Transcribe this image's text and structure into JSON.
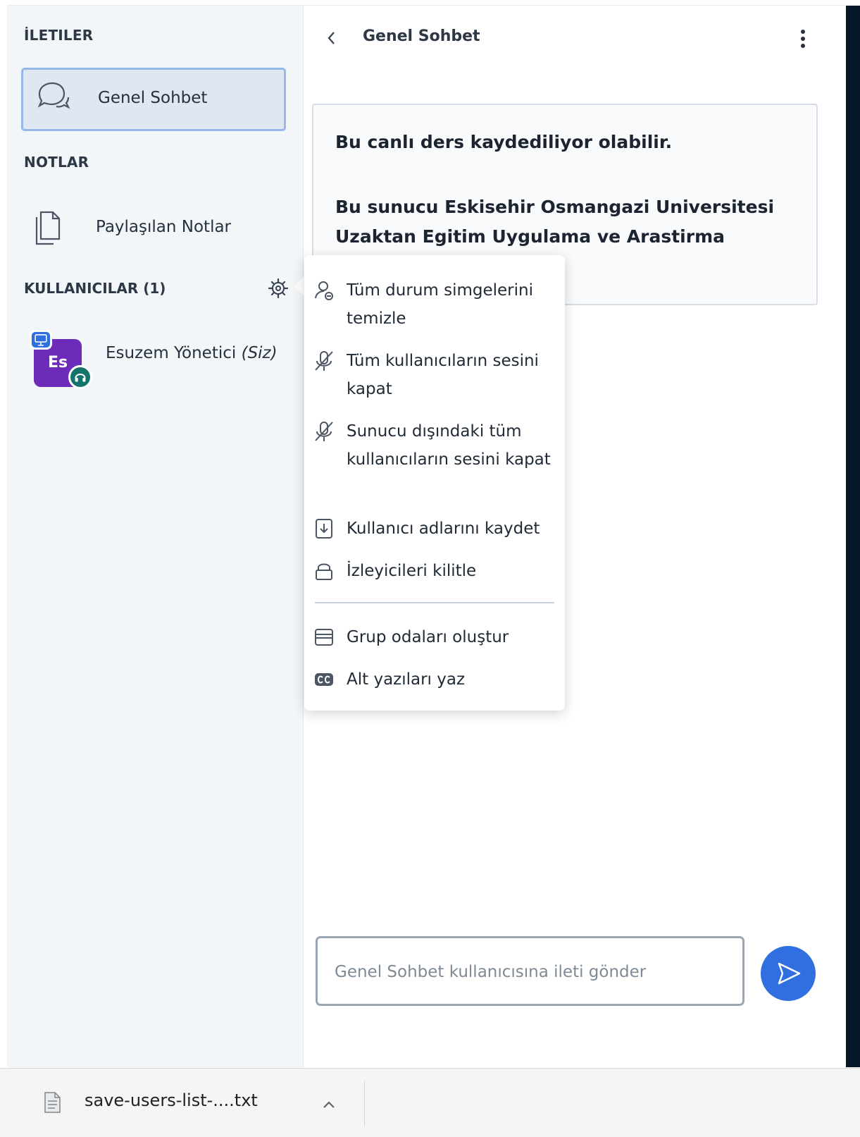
{
  "sidebar": {
    "messages_title": "İLETILER",
    "chat_item": {
      "label": "Genel Sohbet",
      "icon": "chat-bubbles-icon"
    },
    "notes_title": "NOTLAR",
    "notes_item": {
      "label": "Paylaşılan Notlar",
      "icon": "documents-icon"
    },
    "users_title": "KULLANICILAR (1)",
    "settings_icon": "gear-icon",
    "user": {
      "initials": "Es",
      "name": "Esuzem Yönetici",
      "suffix": "(Siz)",
      "presenter_icon": "presenter-icon",
      "audio_icon": "headphones-icon"
    }
  },
  "chat": {
    "back_icon": "chevron-left-icon",
    "title": "Genel Sohbet",
    "options_icon": "kebab-menu-icon",
    "welcome_line1": "Bu canlı ders kaydediliyor olabilir.",
    "welcome_line2": "Bu sunucu Eskisehir Osmangazi Universitesi Uzaktan Egitim Uygulama ve Arastirma",
    "message_placeholder": "Genel Sohbet kullanıcısına ileti gönder",
    "send_icon": "send-icon"
  },
  "settings_menu": {
    "items": [
      {
        "label": "Tüm durum simgelerini temizle",
        "icon": "clear-status-icon"
      },
      {
        "label": "Tüm kullanıcıların sesini kapat",
        "icon": "mute-icon"
      },
      {
        "label": "Sunucu dışındaki tüm kullanıcıların sesini kapat",
        "icon": "mute-icon"
      },
      {
        "label": "Kullanıcı adlarını kaydet",
        "icon": "download-icon"
      },
      {
        "label": "İzleyicileri kilitle",
        "icon": "lock-icon"
      },
      {
        "label": "Grup odaları oluştur",
        "icon": "breakout-room-icon"
      },
      {
        "label": "Alt yazıları yaz",
        "icon": "closed-caption-icon"
      }
    ]
  },
  "download_bar": {
    "file_name": "save-users-list-....txt",
    "file_icon": "text-file-icon",
    "expand_icon": "chevron-up-icon"
  },
  "colors": {
    "sidebar_background": "#f3f6f9",
    "active_border": "#96b8e8",
    "avatar": "#6c2bb8",
    "accent": "#2f6fe0",
    "audio_badge": "#13746b",
    "dark_strip": "#06172a"
  }
}
